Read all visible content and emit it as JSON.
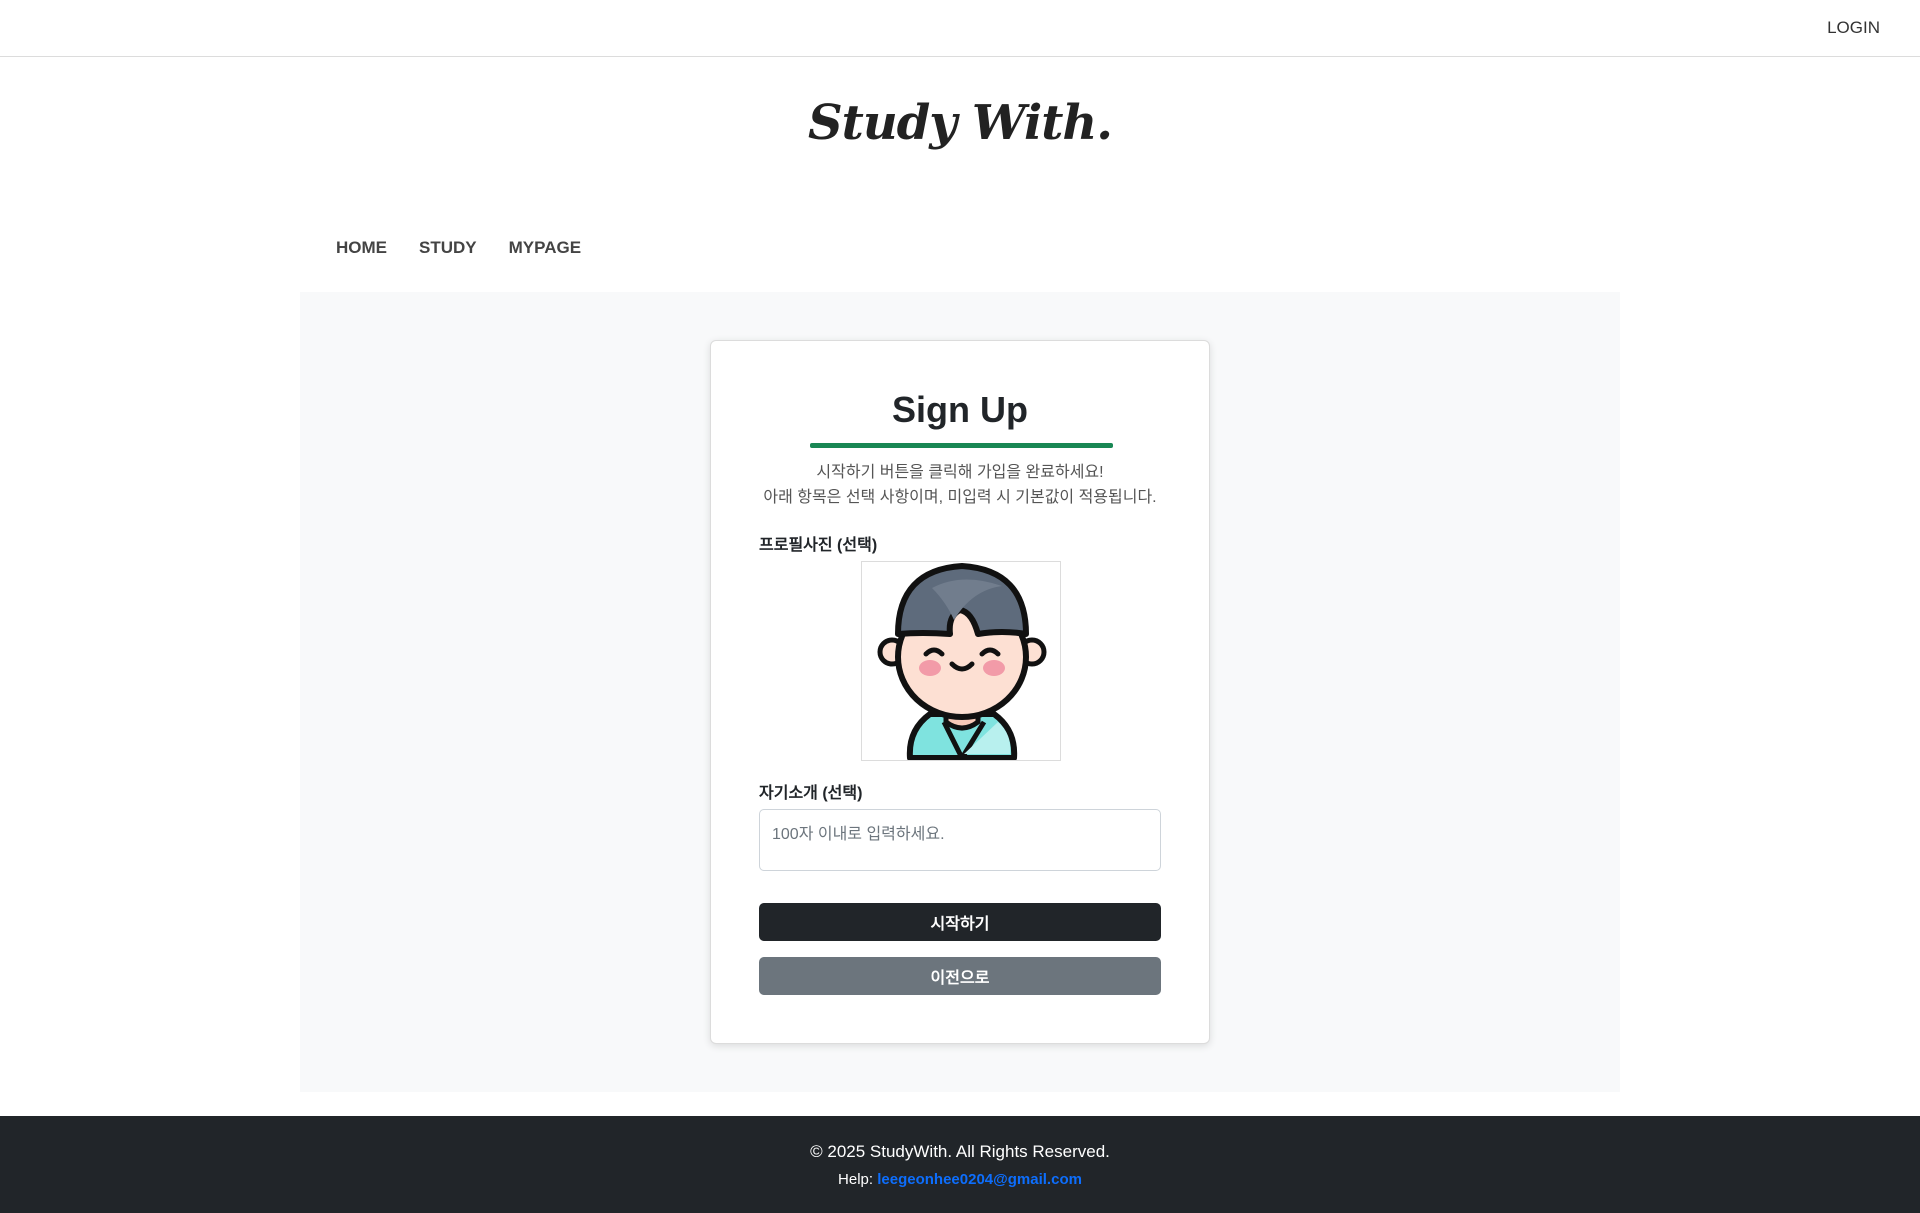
{
  "header": {
    "login_label": "LOGIN",
    "brand": "Study With."
  },
  "nav": {
    "items": [
      {
        "label": "HOME"
      },
      {
        "label": "STUDY"
      },
      {
        "label": "MYPAGE"
      }
    ]
  },
  "signup": {
    "title": "Sign Up",
    "desc_line1": "시작하기 버튼을 클릭해 가입을 완료하세요!",
    "desc_line2": "아래 항목은 선택 사항이며, 미입력 시 기본값이 적용됩니다.",
    "photo_label": "프로필사진 (선택)",
    "intro_label": "자기소개 (선택)",
    "intro_placeholder": "100자 이내로 입력하세요.",
    "intro_value": "",
    "start_button": "시작하기",
    "back_button": "이전으로",
    "accent_color": "#198754",
    "avatar_icon": "profile-avatar-boy"
  },
  "footer": {
    "copyright": "© 2025 StudyWith. All Rights Reserved.",
    "help_label": "Help:",
    "help_email": "leegeonhee0204@gmail.com"
  }
}
